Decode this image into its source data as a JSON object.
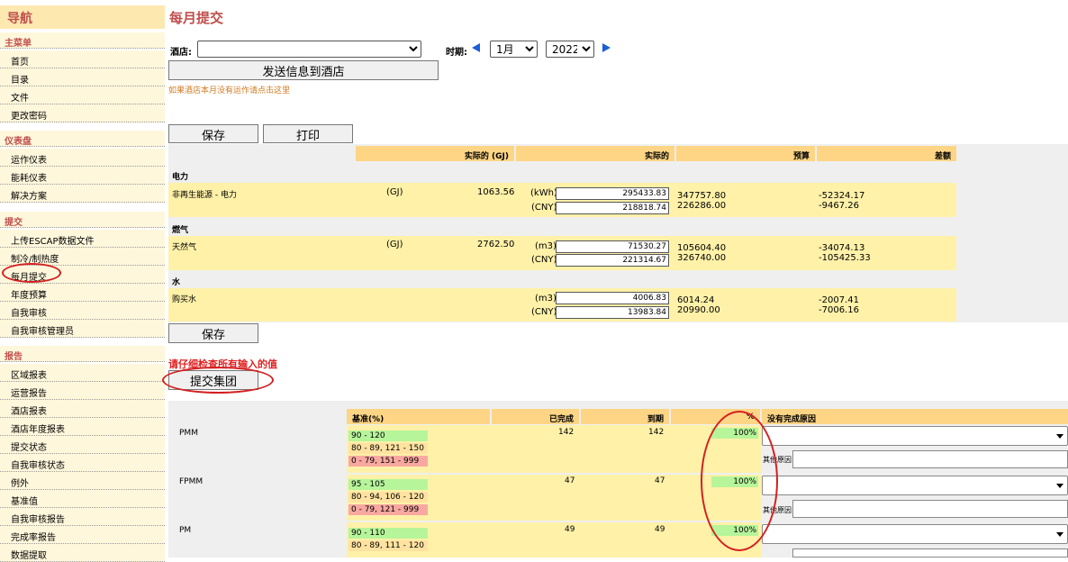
{
  "sidebar": {
    "title": "导航",
    "sections": [
      {
        "label": "主菜单",
        "items": [
          "首页",
          "目录",
          "文件",
          "更改密码"
        ]
      },
      {
        "label": "仪表盘",
        "items": [
          "运作仪表",
          "能耗仪表",
          "解决方案"
        ]
      },
      {
        "label": "提交",
        "items": [
          "上传ESCAP数据文件",
          "制冷/制热度",
          "每月提交",
          "年度预算",
          "自我审核",
          "自我审核管理员"
        ]
      },
      {
        "label": "报告",
        "items": [
          "区域报表",
          "运营报告",
          "酒店报表",
          "酒店年度报表",
          "提交状态",
          "自我审核状态",
          "例外",
          "基准值",
          "自我审核报告",
          "完成率报告",
          "数据提取"
        ]
      }
    ],
    "active_item": "每月提交"
  },
  "header": {
    "title": "每月提交",
    "hotel_label": "酒店:",
    "hotel_value": "",
    "period_label": "时期:",
    "month_value": "1月",
    "year_value": "2022",
    "send_button": "发送信息到酒店",
    "hint_link": "如果酒店本月没有运作请点击这里"
  },
  "toolbar": {
    "save": "保存",
    "print": "打印"
  },
  "utility_table": {
    "headers": {
      "actual_gj": "实际的 (GJ)",
      "actual": "实际的",
      "budget": "预算",
      "diff": "差额"
    },
    "categories": {
      "electricity": "电力",
      "gas": "燃气",
      "water": "水"
    },
    "rows": {
      "electricity": {
        "name": "非再生能源 - 电力",
        "gj_unit": "(GJ)",
        "gj_value": "1063.56",
        "unit1": "(kWh)",
        "val1": "295433.83",
        "unit2": "(CNY)",
        "val2": "218818.74",
        "budget1": "347757.80",
        "budget2": "226286.00",
        "diff1": "-52324.17",
        "diff2": "-9467.26"
      },
      "gas": {
        "name": "天然气",
        "gj_unit": "(GJ)",
        "gj_value": "2762.50",
        "unit1": "(m3)",
        "val1": "71530.27",
        "unit2": "(CNY)",
        "val2": "221314.67",
        "budget1": "105604.40",
        "budget2": "326740.00",
        "diff1": "-34074.13",
        "diff2": "-105425.33"
      },
      "water": {
        "name": "购买水",
        "unit1": "(m3)",
        "val1": "4006.83",
        "unit2": "(CNY)",
        "val2": "13983.84",
        "budget1": "6014.24",
        "budget2": "20990.00",
        "diff1": "-2007.41",
        "diff2": "-7006.16"
      }
    }
  },
  "save_button_2": "保存",
  "warning_text": "请仔细检查所有输入的值",
  "submit_group_button": "提交集团",
  "completion_table": {
    "headers": {
      "benchmark": "基准(%)",
      "completed": "已完成",
      "due": "到期",
      "pct": "%",
      "reason": "没有完成原因"
    },
    "other_label": "其他原因:",
    "rows": [
      {
        "name": "PMM",
        "green": "90 - 120",
        "orange": "80 - 89, 121 - 150",
        "red": "0 - 79, 151 - 999",
        "completed": "142",
        "due": "142",
        "pct": "100%"
      },
      {
        "name": "FPMM",
        "green": "95 - 105",
        "orange": "80 - 94, 106 - 120",
        "red": "0 - 79, 121 - 999",
        "completed": "47",
        "due": "47",
        "pct": "100%"
      },
      {
        "name": "PM",
        "green": "90 - 110",
        "orange": "80 - 89, 111 - 120",
        "red": "",
        "completed": "49",
        "due": "49",
        "pct": "100%"
      }
    ]
  },
  "colors": {
    "accent": "#c0504d",
    "header_bg": "#fdd585",
    "row_bg": "#fff1a8",
    "ok": "#b6f59a",
    "warn": "#ffe2a0",
    "bad": "#f8a8a0",
    "annotation": "#d42020"
  }
}
